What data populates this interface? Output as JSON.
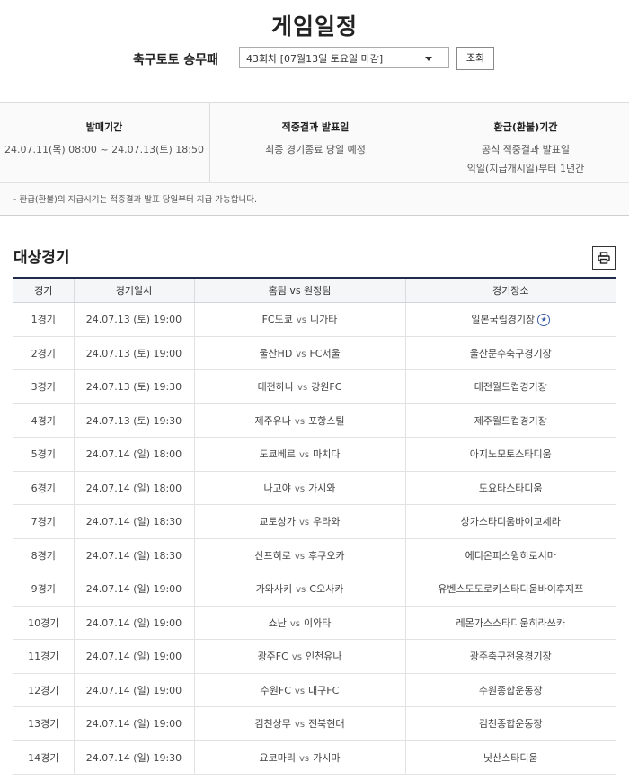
{
  "page": {
    "title": "게임일정"
  },
  "selector": {
    "game_type": "축구토토 승무패",
    "round_value": "43회차 [07월13일 토요일 마감]",
    "search_label": "조회"
  },
  "info": {
    "sale_period": {
      "heading": "발매기간",
      "value": "24.07.11(목) 08:00 ~ 24.07.13(토) 18:50"
    },
    "result_announce": {
      "heading": "적중결과 발표일",
      "value": "최종 경기종료 당일 예정"
    },
    "refund_period": {
      "heading": "환급(환불)기간",
      "line1": "공식 적중결과 발표일",
      "line2": "익일(지급개시일)부터 1년간"
    },
    "notice": "- 환급(환불)의 지급시기는 적중결과 발표 당일부터 지급 가능합니다."
  },
  "section": {
    "title": "대상경기",
    "print_icon": "printer-icon"
  },
  "table": {
    "headers": [
      "경기",
      "경기일시",
      "홈팀 vs 원정팀",
      "경기장소"
    ],
    "vs_label": "vs",
    "rows": [
      {
        "no": "1경기",
        "datetime": "24.07.13 (토) 19:00",
        "home": "FC도쿄",
        "away": "니가타",
        "venue": "일본국립경기장",
        "badge": "★"
      },
      {
        "no": "2경기",
        "datetime": "24.07.13 (토) 19:00",
        "home": "울산HD",
        "away": "FC서울",
        "venue": "울산문수축구경기장"
      },
      {
        "no": "3경기",
        "datetime": "24.07.13 (토) 19:30",
        "home": "대전하나",
        "away": "강원FC",
        "venue": "대전월드컵경기장"
      },
      {
        "no": "4경기",
        "datetime": "24.07.13 (토) 19:30",
        "home": "제주유나",
        "away": "포항스틸",
        "venue": "제주월드컵경기장"
      },
      {
        "no": "5경기",
        "datetime": "24.07.14 (일) 18:00",
        "home": "도쿄베르",
        "away": "마치다",
        "venue": "아지노모토스타디움"
      },
      {
        "no": "6경기",
        "datetime": "24.07.14 (일) 18:00",
        "home": "나고야",
        "away": "가시와",
        "venue": "도요타스타디움"
      },
      {
        "no": "7경기",
        "datetime": "24.07.14 (일) 18:30",
        "home": "교토상가",
        "away": "우라와",
        "venue": "상가스타디움바이교세라"
      },
      {
        "no": "8경기",
        "datetime": "24.07.14 (일) 18:30",
        "home": "산프히로",
        "away": "후쿠오카",
        "venue": "에디온피스윙히로시마"
      },
      {
        "no": "9경기",
        "datetime": "24.07.14 (일) 19:00",
        "home": "가와사키",
        "away": "C오사카",
        "venue": "유벤스도도로키스타디움바이후지쯔"
      },
      {
        "no": "10경기",
        "datetime": "24.07.14 (일) 19:00",
        "home": "쇼난",
        "away": "이와타",
        "venue": "레몬가스스타디움히라쓰카"
      },
      {
        "no": "11경기",
        "datetime": "24.07.14 (일) 19:00",
        "home": "광주FC",
        "away": "인천유나",
        "venue": "광주축구전용경기장"
      },
      {
        "no": "12경기",
        "datetime": "24.07.14 (일) 19:00",
        "home": "수원FC",
        "away": "대구FC",
        "venue": "수원종합운동장"
      },
      {
        "no": "13경기",
        "datetime": "24.07.14 (일) 19:00",
        "home": "김천상무",
        "away": "전북현대",
        "venue": "김천종합운동장"
      },
      {
        "no": "14경기",
        "datetime": "24.07.14 (일) 19:30",
        "home": "요코마리",
        "away": "가시마",
        "venue": "닛산스타디움"
      }
    ]
  }
}
